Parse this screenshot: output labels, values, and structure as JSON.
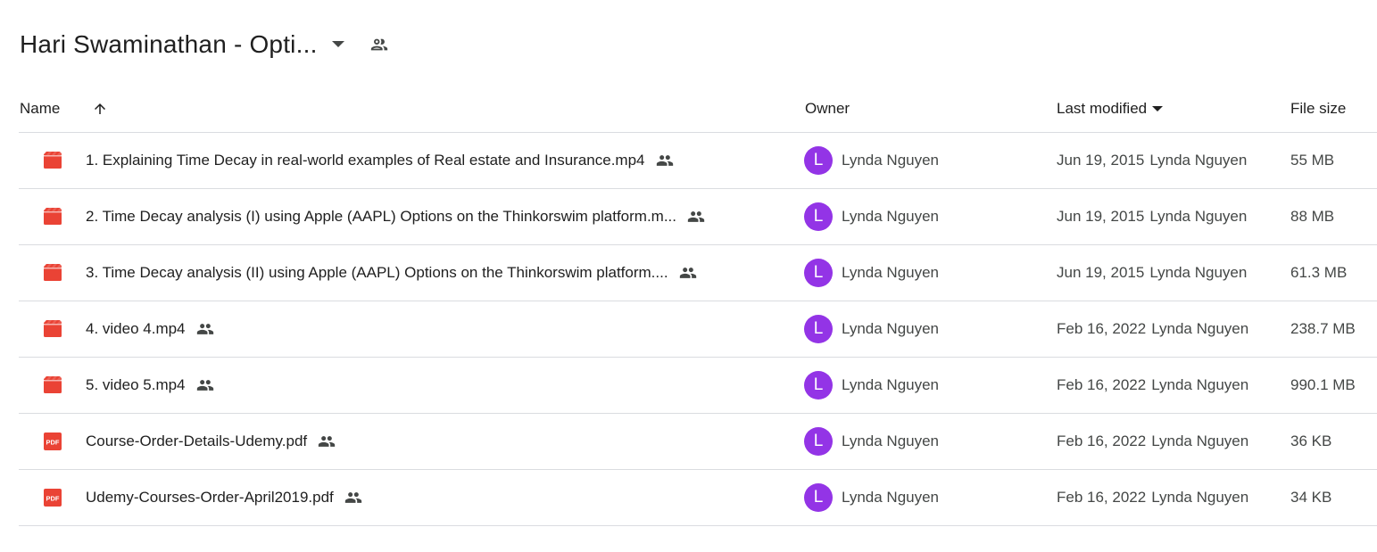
{
  "folder": {
    "title": "Hari Swaminathan - Opti..."
  },
  "columns": {
    "name": "Name",
    "owner": "Owner",
    "last_modified": "Last modified",
    "file_size": "File size"
  },
  "colors": {
    "video_icon": "#ea4335",
    "pdf_icon": "#ea4335",
    "avatar": "#9334e6",
    "divider": "#dadce0"
  },
  "files": [
    {
      "name": "1. Explaining Time Decay in real-world examples of Real estate and Insurance.mp4",
      "type": "video-file-icon",
      "shared_icon": "people-icon",
      "owner": "Lynda Nguyen",
      "owner_initial": "L",
      "modified_date": "Jun 19, 2015",
      "modified_by": "Lynda Nguyen",
      "size": "55 MB"
    },
    {
      "name": "2. Time Decay analysis (I) using Apple (AAPL) Options on the Thinkorswim platform.m...",
      "type": "video-file-icon",
      "shared_icon": "people-icon",
      "owner": "Lynda Nguyen",
      "owner_initial": "L",
      "modified_date": "Jun 19, 2015",
      "modified_by": "Lynda Nguyen",
      "size": "88 MB"
    },
    {
      "name": "3. Time Decay analysis (II) using Apple (AAPL) Options on the Thinkorswim platform....",
      "type": "video-file-icon",
      "shared_icon": "people-icon",
      "owner": "Lynda Nguyen",
      "owner_initial": "L",
      "modified_date": "Jun 19, 2015",
      "modified_by": "Lynda Nguyen",
      "size": "61.3 MB"
    },
    {
      "name": "4. video 4.mp4",
      "type": "video-file-icon",
      "shared_icon": "people-icon",
      "owner": "Lynda Nguyen",
      "owner_initial": "L",
      "modified_date": "Feb 16, 2022",
      "modified_by": "Lynda Nguyen",
      "size": "238.7 MB"
    },
    {
      "name": "5. video 5.mp4",
      "type": "video-file-icon",
      "shared_icon": "people-icon",
      "owner": "Lynda Nguyen",
      "owner_initial": "L",
      "modified_date": "Feb 16, 2022",
      "modified_by": "Lynda Nguyen",
      "size": "990.1 MB"
    },
    {
      "name": "Course-Order-Details-Udemy.pdf",
      "type": "pdf-file-icon",
      "shared_icon": "people-icon",
      "owner": "Lynda Nguyen",
      "owner_initial": "L",
      "modified_date": "Feb 16, 2022",
      "modified_by": "Lynda Nguyen",
      "size": "36 KB"
    },
    {
      "name": "Udemy-Courses-Order-April2019.pdf",
      "type": "pdf-file-icon",
      "shared_icon": "people-icon",
      "owner": "Lynda Nguyen",
      "owner_initial": "L",
      "modified_date": "Feb 16, 2022",
      "modified_by": "Lynda Nguyen",
      "size": "34 KB"
    }
  ]
}
